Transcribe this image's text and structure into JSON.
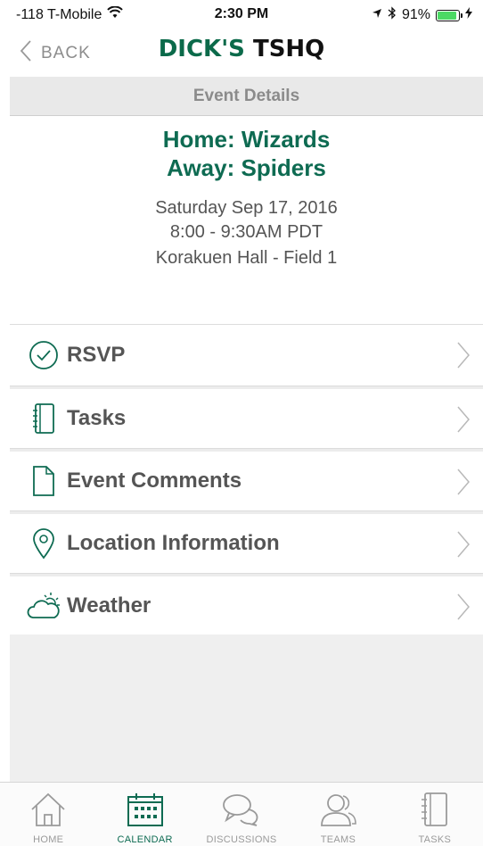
{
  "status_bar": {
    "carrier": "-118 T-Mobile",
    "time": "2:30 PM",
    "battery_percent": "91%",
    "battery_level": 0.91
  },
  "nav": {
    "back_label": "BACK",
    "logo_part1": "DICK'S",
    "logo_part2": "TSHQ"
  },
  "header": {
    "title": "Event Details"
  },
  "event": {
    "home": "Home: Wizards",
    "away": "Away: Spiders",
    "date": "Saturday Sep 17, 2016",
    "time": "8:00 - 9:30AM PDT",
    "location": "Korakuen Hall - Field 1"
  },
  "menu": {
    "items": [
      {
        "label": "RSVP",
        "icon": "check-circle-icon"
      },
      {
        "label": "Tasks",
        "icon": "notebook-icon"
      },
      {
        "label": "Event Comments",
        "icon": "document-icon"
      },
      {
        "label": "Location Information",
        "icon": "map-pin-icon"
      },
      {
        "label": "Weather",
        "icon": "cloud-sun-icon"
      }
    ]
  },
  "tabs": [
    {
      "label": "HOME",
      "icon": "home-icon",
      "active": false
    },
    {
      "label": "CALENDAR",
      "icon": "calendar-icon",
      "active": true
    },
    {
      "label": "DISCUSSIONS",
      "icon": "chat-bubbles-icon",
      "active": false
    },
    {
      "label": "TEAMS",
      "icon": "people-icon",
      "active": false
    },
    {
      "label": "TASKS",
      "icon": "notebook-icon",
      "active": false
    }
  ],
  "colors": {
    "brand_green": "#0e6b52",
    "header_gray": "#e9e9e9",
    "battery_green": "#4cd964"
  }
}
